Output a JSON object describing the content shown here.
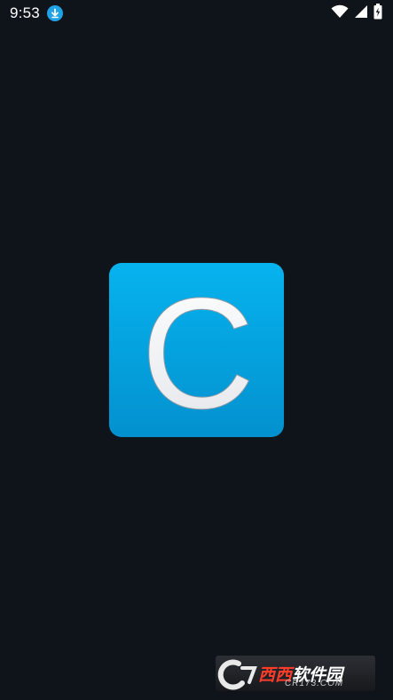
{
  "status_bar": {
    "time": "9:53",
    "icons": [
      "download-icon",
      "wifi-icon",
      "cellular-signal-icon",
      "battery-charging-icon"
    ]
  },
  "splash": {
    "logo_letter": "C",
    "logo_color": "#06b3ee",
    "background_color": "#0f131a"
  },
  "watermark": {
    "brand_red": "西西",
    "brand_white": "软件园",
    "domain": "CR173.COM"
  }
}
